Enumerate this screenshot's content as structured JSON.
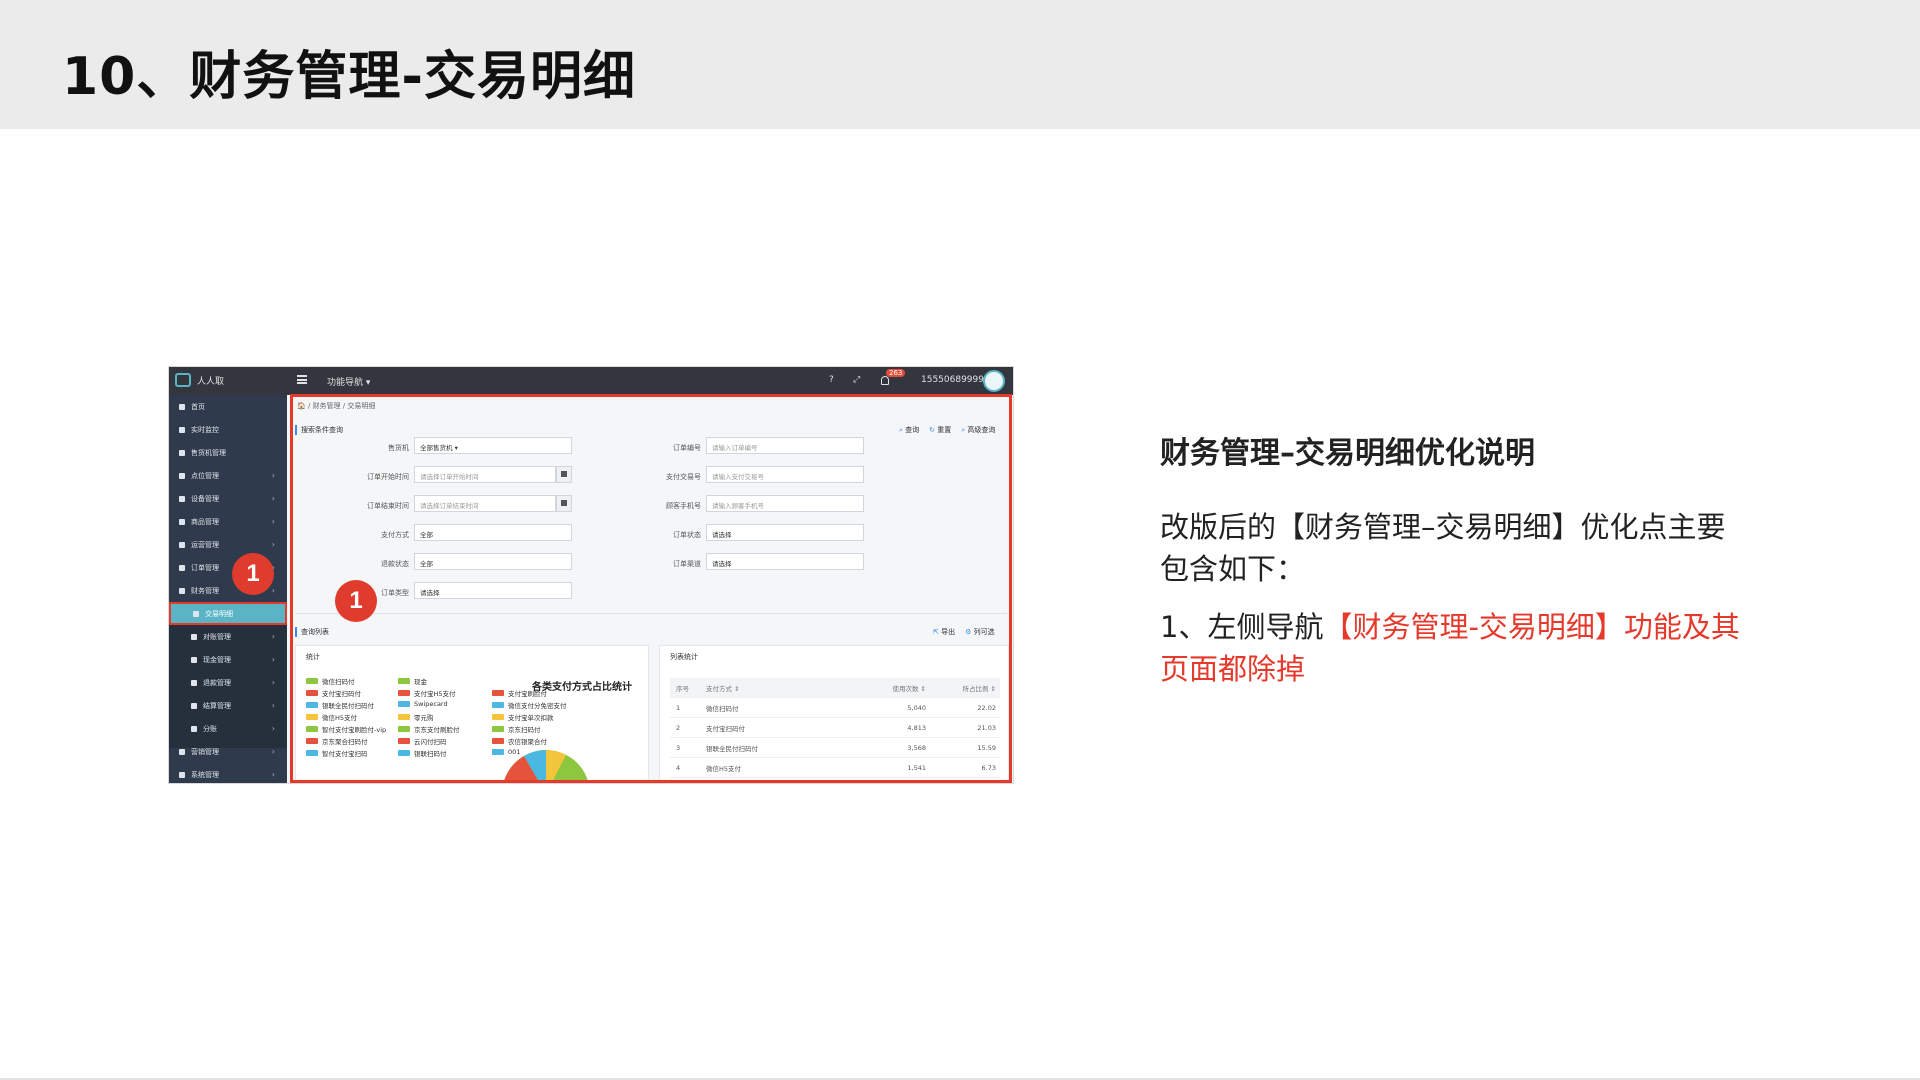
{
  "slide": {
    "title": "10、财务管理-交易明细"
  },
  "screenshot": {
    "topbar": {
      "brand": "人人取",
      "func_nav": "功能导航 ▾",
      "help": "?",
      "expand": "⤢",
      "badge": "263",
      "user": "15550689999 ▾"
    },
    "sidebar": {
      "items": [
        {
          "label": "首页",
          "arrow": ""
        },
        {
          "label": "实时监控",
          "arrow": ""
        },
        {
          "label": "售货机管理",
          "arrow": ""
        },
        {
          "label": "点位管理",
          "arrow": "›"
        },
        {
          "label": "设备管理",
          "arrow": "›"
        },
        {
          "label": "商品管理",
          "arrow": "›"
        },
        {
          "label": "运营管理",
          "arrow": "›"
        },
        {
          "label": "订单管理",
          "arrow": "›"
        },
        {
          "label": "财务管理",
          "arrow": "›"
        }
      ],
      "sub_items": [
        {
          "label": "交易明细",
          "arrow": ""
        },
        {
          "label": "对账管理",
          "arrow": "›"
        },
        {
          "label": "现金管理",
          "arrow": "›"
        },
        {
          "label": "退款管理",
          "arrow": "›"
        },
        {
          "label": "结算管理",
          "arrow": "›"
        },
        {
          "label": "分账",
          "arrow": "›"
        }
      ],
      "bottom_items": [
        {
          "label": "营销管理",
          "arrow": "›"
        },
        {
          "label": "系统管理",
          "arrow": "›"
        }
      ]
    },
    "breadcrumb": "🏠 / 财务管理 / 交易明细",
    "search_panel": {
      "title": "搜索条件查询",
      "actions": [
        "查询",
        "重置",
        "高级查询"
      ]
    },
    "form": {
      "left": [
        {
          "label": "售货机",
          "value": "全部售货机 ▾",
          "filled": true
        },
        {
          "label": "订单开始时间",
          "value": "请选择订单开始时间",
          "filled": false
        },
        {
          "label": "订单结束时间",
          "value": "请选择订单结束时间",
          "filled": false
        },
        {
          "label": "支付方式",
          "value": "全部",
          "filled": true
        },
        {
          "label": "退款状态",
          "value": "全部",
          "filled": true
        },
        {
          "label": "订单类型",
          "value": "请选择",
          "filled": true
        }
      ],
      "right": [
        {
          "label": "订单编号",
          "value": "请输入订单编号"
        },
        {
          "label": "支付交易号",
          "value": "请输入支付交易号"
        },
        {
          "label": "顾客手机号",
          "value": "请输入顾客手机号"
        },
        {
          "label": "订单状态",
          "value": "请选择"
        },
        {
          "label": "订单渠道",
          "value": "请选择"
        }
      ]
    },
    "list_panel": {
      "title": "查询列表",
      "actions": [
        "导出",
        "列可选"
      ]
    },
    "stats_card": {
      "title": "统计",
      "pie_title": "各类支付方式占比统计",
      "legend_col1": [
        {
          "label": "微信扫码付",
          "color": "#8dc63f"
        },
        {
          "label": "支付宝扫码付",
          "color": "#e5533d"
        },
        {
          "label": "银联全民付扫码付",
          "color": "#4ab8e0"
        },
        {
          "label": "微信H5支付",
          "color": "#f2c53d"
        },
        {
          "label": "智付支付宝刷脸付-vip",
          "color": "#8dc63f"
        },
        {
          "label": "京东聚合扫码付",
          "color": "#e5533d"
        },
        {
          "label": "智付支付宝扫码",
          "color": "#4ab8e0"
        }
      ],
      "legend_col2": [
        {
          "label": "现金",
          "color": "#8dc63f"
        },
        {
          "label": "支付宝H5支付",
          "color": "#e5533d"
        },
        {
          "label": "Swipecard",
          "color": "#4ab8e0"
        },
        {
          "label": "零元购",
          "color": "#f2c53d"
        },
        {
          "label": "京东支付刷脸付",
          "color": "#8dc63f"
        },
        {
          "label": "云闪付扫码",
          "color": "#e5533d"
        },
        {
          "label": "银联扫码付",
          "color": "#4ab8e0"
        }
      ],
      "legend_col3": [
        {
          "label": "支付宝刷脸付",
          "color": "#e5533d"
        },
        {
          "label": "微信支付分免密支付",
          "color": "#4ab8e0"
        },
        {
          "label": "支付宝单次扣款",
          "color": "#f2c53d"
        },
        {
          "label": "京东扫码付",
          "color": "#8dc63f"
        },
        {
          "label": "农信银聚合付",
          "color": "#e5533d"
        },
        {
          "label": "001",
          "color": "#4ab8e0"
        }
      ]
    },
    "table_card": {
      "title": "列表统计",
      "headers": [
        "序号",
        "支付方式 ⇕",
        "使用次数 ⇕",
        "所占比例 ⇕"
      ],
      "rows": [
        [
          "1",
          "微信扫码付",
          "5,040",
          "22.02"
        ],
        [
          "2",
          "支付宝扫码付",
          "4,813",
          "21.03"
        ],
        [
          "3",
          "银联全民付扫码付",
          "3,568",
          "15.59"
        ],
        [
          "4",
          "微信H5支付",
          "1,541",
          "6.73"
        ]
      ]
    },
    "markers": [
      "1",
      "1"
    ]
  },
  "note": {
    "heading": "财务管理–交易明细优化说明",
    "body": "改版后的【财务管理–交易明细】优化点主要包含如下：",
    "point_prefix": "1、左侧导航",
    "point_highlight": "【财务管理-交易明细】功能及其页面都除掉",
    "highlight_color": "#e5392b"
  }
}
